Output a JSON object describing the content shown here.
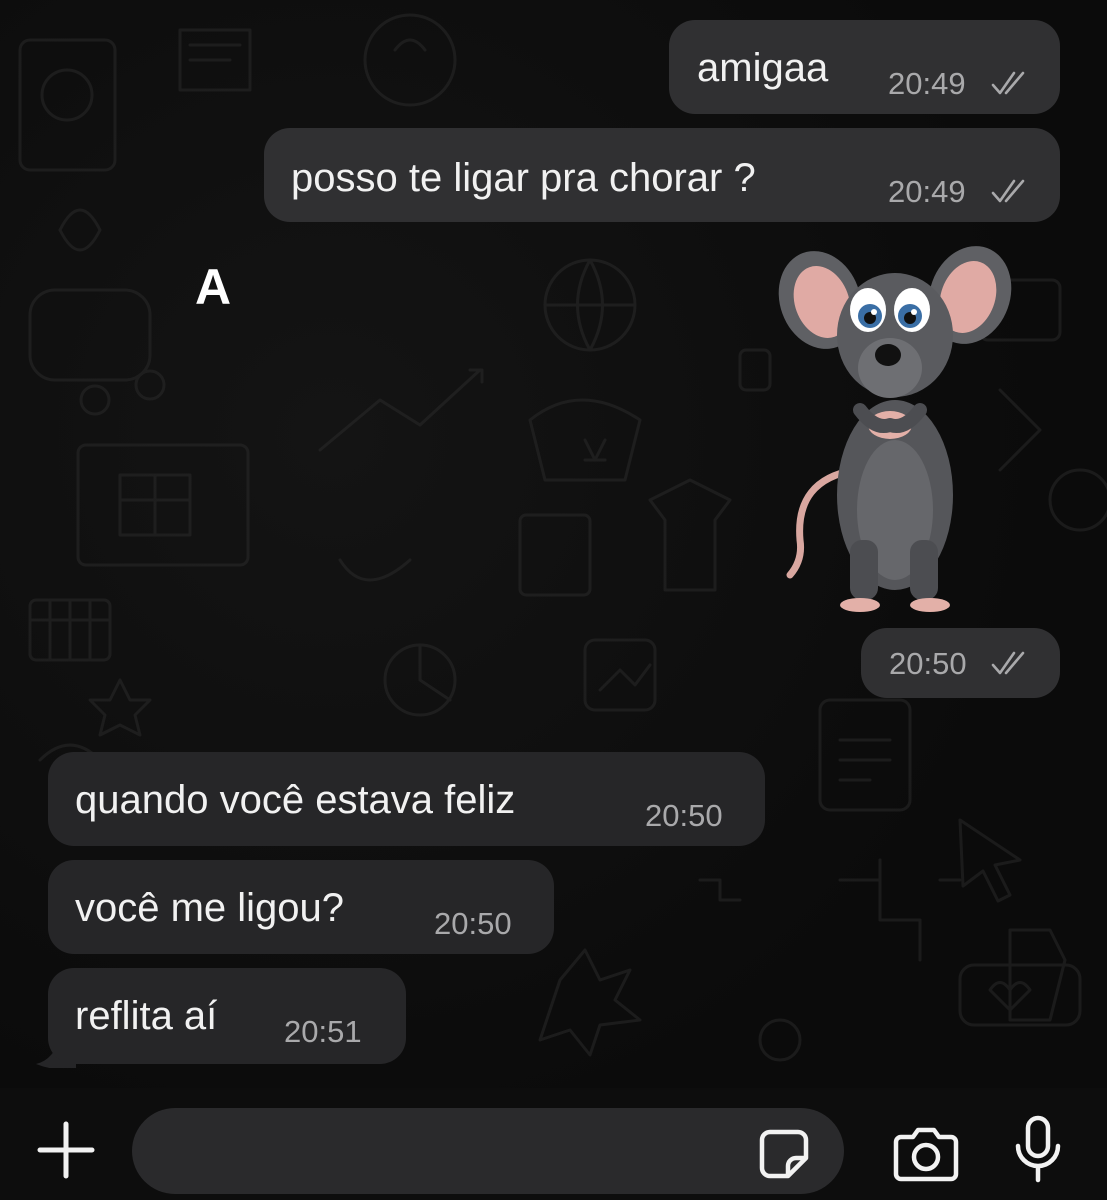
{
  "chat": {
    "sender_initial": "A",
    "messages": [
      {
        "direction": "outgoing",
        "text": "amigaa",
        "time": "20:49",
        "status": "read"
      },
      {
        "direction": "outgoing",
        "text": "posso te ligar pra chorar ?",
        "time": "20:49",
        "status": "read"
      },
      {
        "direction": "outgoing",
        "type": "sticker",
        "sticker": "sad-mouse-sticker",
        "time": "20:50",
        "status": "read"
      },
      {
        "direction": "incoming",
        "text": "quando você estava feliz",
        "time": "20:50"
      },
      {
        "direction": "incoming",
        "text": "você me ligou?",
        "time": "20:50"
      },
      {
        "direction": "incoming",
        "text": "reflita aí",
        "time": "20:51"
      }
    ]
  },
  "composer": {
    "input_value": "",
    "icons": [
      "plus-icon",
      "sticker-icon",
      "camera-icon",
      "microphone-icon"
    ]
  },
  "colors": {
    "background": "#0b0b0b",
    "outgoing_bubble": "#303032",
    "incoming_bubble": "#262628",
    "timestamp": "#a9a9ab",
    "read_ticks": "#a9a9ab"
  }
}
